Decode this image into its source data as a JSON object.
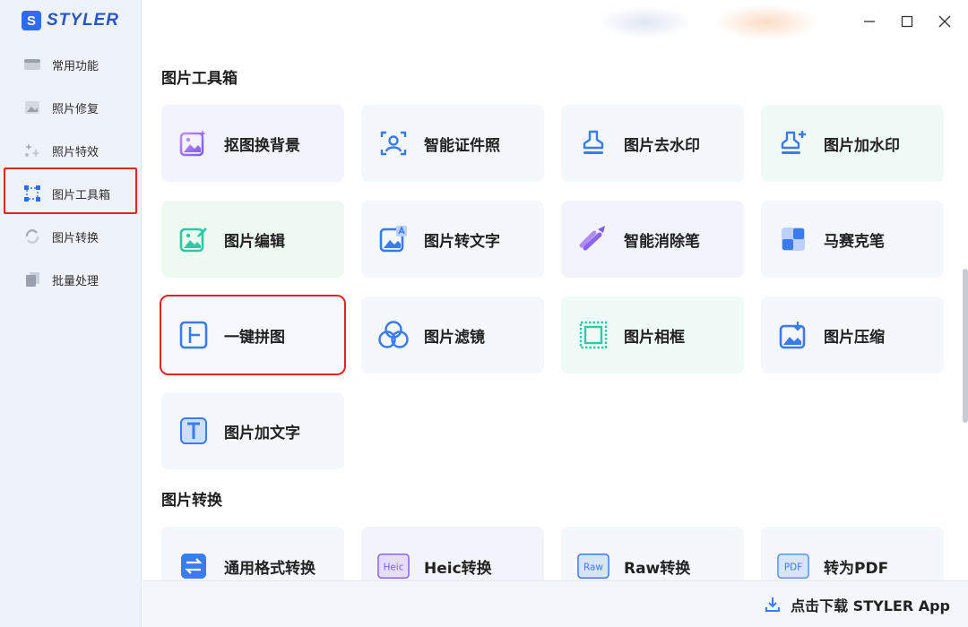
{
  "app": {
    "logo_letter": "S",
    "name": "STYLER"
  },
  "sidebar": {
    "items": [
      {
        "label": "常用功能",
        "icon": "common-functions-icon"
      },
      {
        "label": "照片修复",
        "icon": "photo-repair-icon"
      },
      {
        "label": "照片特效",
        "icon": "photo-effects-icon"
      },
      {
        "label": "图片工具箱",
        "icon": "image-toolbox-icon",
        "active": true
      },
      {
        "label": "图片转换",
        "icon": "image-convert-icon"
      },
      {
        "label": "批量处理",
        "icon": "batch-process-icon"
      }
    ]
  },
  "window": {
    "minimize": "minimize-icon",
    "maximize": "maximize-icon",
    "close": "close-icon"
  },
  "sections": {
    "toolbox": {
      "title": "图片工具箱",
      "tools": [
        {
          "label": "抠图换背景",
          "icon": "cutout-background-icon"
        },
        {
          "label": "智能证件照",
          "icon": "id-photo-icon"
        },
        {
          "label": "图片去水印",
          "icon": "remove-watermark-icon"
        },
        {
          "label": "图片加水印",
          "icon": "add-watermark-icon"
        },
        {
          "label": "图片编辑",
          "icon": "image-edit-icon"
        },
        {
          "label": "图片转文字",
          "icon": "image-to-text-icon"
        },
        {
          "label": "智能消除笔",
          "icon": "smart-eraser-icon"
        },
        {
          "label": "马赛克笔",
          "icon": "mosaic-pen-icon"
        },
        {
          "label": "一键拼图",
          "icon": "collage-icon"
        },
        {
          "label": "图片滤镜",
          "icon": "image-filter-icon"
        },
        {
          "label": "图片相框",
          "icon": "image-frame-icon"
        },
        {
          "label": "图片压缩",
          "icon": "image-compress-icon"
        },
        {
          "label": "图片加文字",
          "icon": "add-text-icon"
        }
      ]
    },
    "convert": {
      "title": "图片转换",
      "tools": [
        {
          "label": "通用格式转换",
          "icon": "format-convert-icon"
        },
        {
          "label": "Heic转换",
          "icon": "heic-icon",
          "badge": "Heic"
        },
        {
          "label": "Raw转换",
          "icon": "raw-icon",
          "badge": "Raw"
        },
        {
          "label": "转为PDF",
          "icon": "pdf-icon",
          "badge": "PDF"
        }
      ]
    }
  },
  "footer": {
    "download_label": "点击下载 STYLER App",
    "icon": "download-icon"
  },
  "colors": {
    "accent": "#2f6cf5",
    "highlight": "#e02424",
    "sidebar_bg": "#eef3fb",
    "card_bg": "#f4f7fc"
  }
}
